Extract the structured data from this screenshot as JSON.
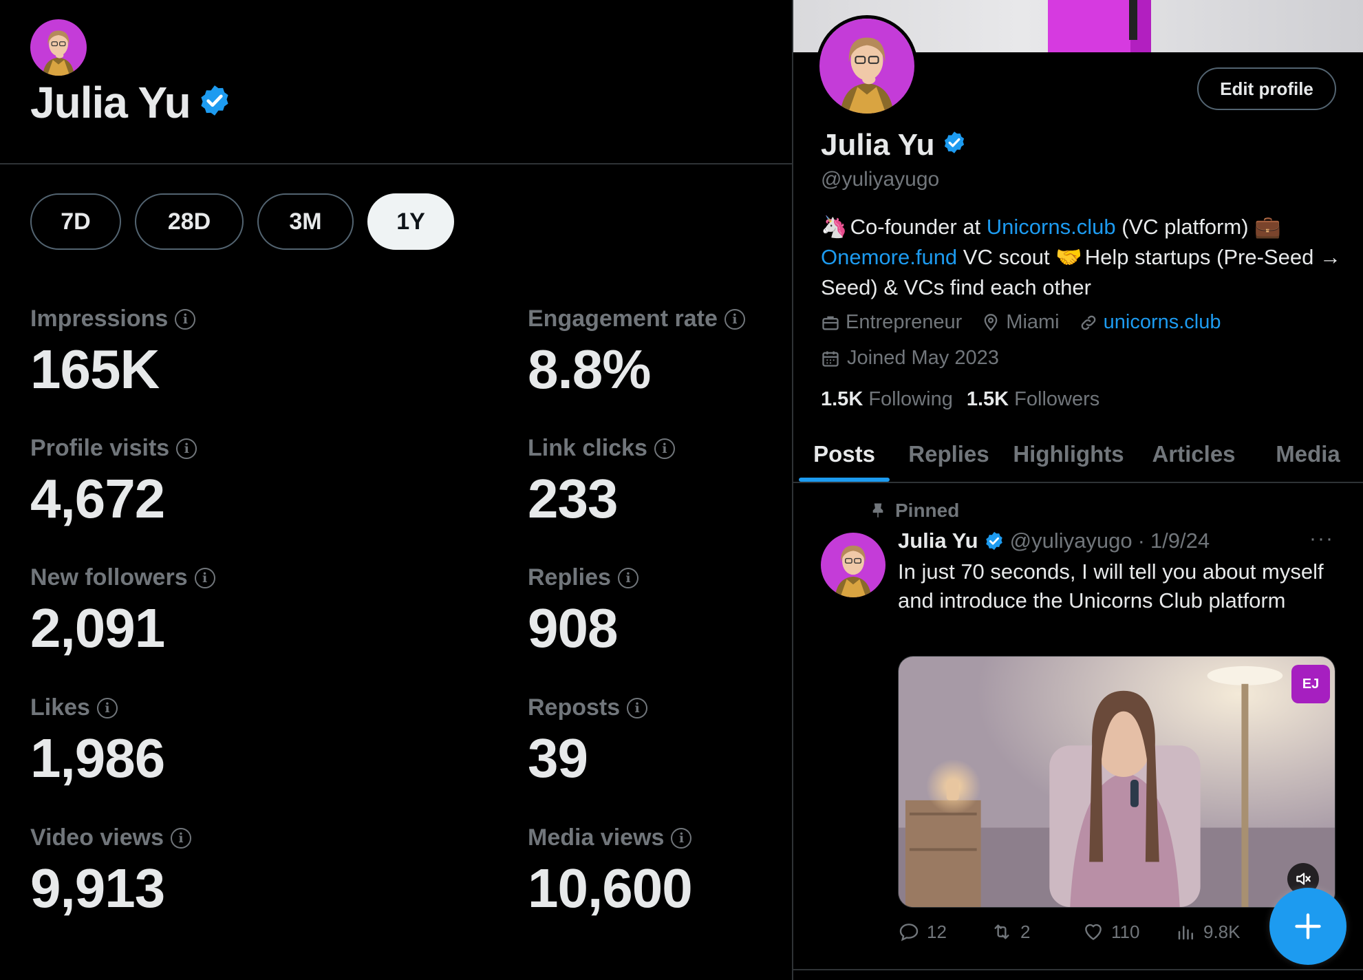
{
  "analytics": {
    "name": "Julia Yu",
    "verified": true,
    "ranges": [
      {
        "label": "7D",
        "active": false
      },
      {
        "label": "28D",
        "active": false
      },
      {
        "label": "3M",
        "active": false
      },
      {
        "label": "1Y",
        "active": true
      }
    ],
    "stats": [
      {
        "label": "Impressions",
        "value": "165K"
      },
      {
        "label": "Engagement rate",
        "value": "8.8%"
      },
      {
        "label": "Profile visits",
        "value": "4,672"
      },
      {
        "label": "Link clicks",
        "value": "233"
      },
      {
        "label": "New followers",
        "value": "2,091"
      },
      {
        "label": "Replies",
        "value": "908"
      },
      {
        "label": "Likes",
        "value": "1,986"
      },
      {
        "label": "Reposts",
        "value": "39"
      },
      {
        "label": "Video views",
        "value": "9,913"
      },
      {
        "label": "Media views",
        "value": "10,600"
      }
    ]
  },
  "profile": {
    "edit_label": "Edit profile",
    "name": "Julia Yu",
    "handle": "@yuliyayugo",
    "bio": {
      "emoji1": "🦄",
      "part1": " Co-founder at ",
      "link1": "Unicorns.club",
      "part2": " (VC platform) ",
      "emoji2": "💼",
      "link2": "Onemore.fund",
      "part3": " VC scout ",
      "emoji3": "🤝",
      "part4": " Help startups (Pre-Seed → Seed) & VCs find each other"
    },
    "meta": {
      "job": "Entrepreneur",
      "location": "Miami",
      "website": "unicorns.club",
      "joined": "Joined May 2023"
    },
    "following_count": "1.5K",
    "following_label": "Following",
    "followers_count": "1.5K",
    "followers_label": "Followers",
    "tabs": [
      "Posts",
      "Replies",
      "Highlights",
      "Articles",
      "Media"
    ],
    "active_tab": "Posts"
  },
  "post": {
    "pinned_label": "Pinned",
    "author": "Julia Yu",
    "handle": "@yuliyayugo",
    "separator": "·",
    "date": "1/9/24",
    "more": "···",
    "text": "In just 70 seconds, I will tell you about myself and introduce the Unicorns Club platform",
    "badge_text": "EJ",
    "replies": "12",
    "reposts": "2",
    "likes": "110",
    "views": "9.8K"
  },
  "colors": {
    "accent": "#1d9bf0",
    "background": "#000000",
    "muted": "#71767b",
    "text": "#e7e9ea",
    "border": "#2f3336",
    "avatar_bg": "#c43cd8"
  },
  "icons": {
    "verified": "verified-badge-icon",
    "info": "info-icon",
    "briefcase": "briefcase-icon",
    "location": "location-pin-icon",
    "link": "link-icon",
    "calendar": "calendar-icon",
    "pin": "pin-icon",
    "reply": "reply-icon",
    "repost": "repost-icon",
    "like": "heart-icon",
    "views": "views-icon",
    "mute": "mute-icon",
    "compose": "plus-icon"
  }
}
